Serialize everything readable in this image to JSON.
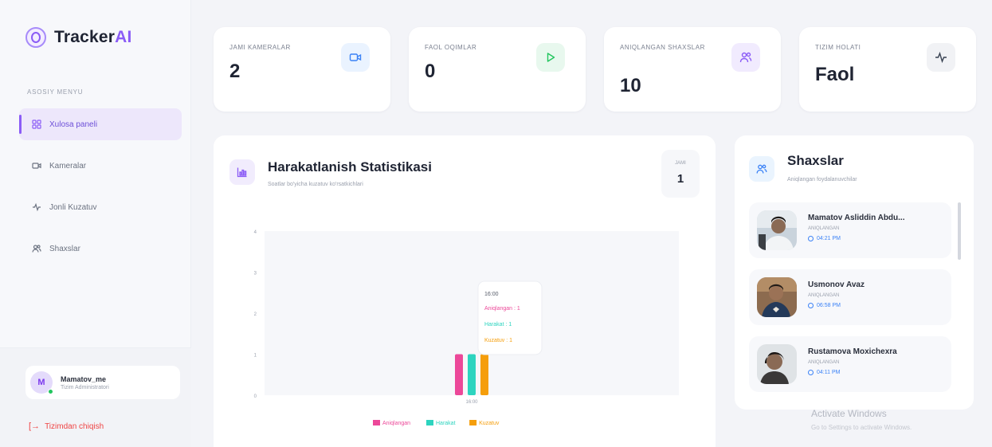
{
  "brand": {
    "name_main": "Tracker",
    "name_accent": "AI"
  },
  "sidebar": {
    "section_label": "ASOSIY MENYU",
    "items": [
      {
        "label": "Xulosa paneli",
        "icon": "dashboard-grid-icon",
        "active": true
      },
      {
        "label": "Kameralar",
        "icon": "camera-icon",
        "active": false
      },
      {
        "label": "Jonli Kuzatuv",
        "icon": "pulse-icon",
        "active": false
      },
      {
        "label": "Shaxslar",
        "icon": "users-icon",
        "active": false
      }
    ],
    "user": {
      "initial": "M",
      "name": "Mamatov_me",
      "role": "Tizim Administratori"
    },
    "logout_label": "Tizimdan chiqish"
  },
  "stats": [
    {
      "label": "JAMI KAMERALAR",
      "value": "2",
      "icon": "camera-icon",
      "color": "#3b82f6",
      "bg": "#eaf3ff"
    },
    {
      "label": "FAOL OQIMLAR",
      "value": "0",
      "icon": "play-icon",
      "color": "#22c55e",
      "bg": "#e8f8ee"
    },
    {
      "label": "ANIQLANGAN SHAXSLAR",
      "value": "10",
      "icon": "users-icon",
      "color": "#8b5cf6",
      "bg": "#f1ebfe"
    },
    {
      "label": "TIZIM HOLATI",
      "value": "Faol",
      "icon": "pulse-icon",
      "color": "#374151",
      "bg": "#f1f2f5"
    }
  ],
  "chart": {
    "title": "Harakatlanish Statistikasi",
    "subtitle": "Soatlar bo'yicha kuzatuv ko'rsatkichlari",
    "jami_label": "JAMI",
    "jami_value": "1"
  },
  "chart_data": {
    "type": "bar",
    "categories": [
      "16:00"
    ],
    "series": [
      {
        "name": "Aniqlangan",
        "values": [
          1
        ],
        "color": "#ec4899"
      },
      {
        "name": "Harakat",
        "values": [
          1
        ],
        "color": "#2dd4bf"
      },
      {
        "name": "Kuzatuv",
        "values": [
          1
        ],
        "color": "#f59e0b"
      }
    ],
    "ylim": [
      0,
      4
    ],
    "yticks": [
      "0",
      "1",
      "2",
      "3",
      "4"
    ],
    "xlabel": "",
    "ylabel": "",
    "grid": false,
    "legend": "bottom",
    "tooltip": {
      "title": "16:00",
      "lines": [
        "Aniqlangan : 1",
        "Harakat : 1",
        "Kuzatuv : 1"
      ]
    }
  },
  "people": {
    "title": "Shaxslar",
    "subtitle": "Aniqlangan foydalanuvchilar",
    "list": [
      {
        "name": "Mamatov Asliddin Abdu...",
        "meta": "ANIQLANGAN",
        "time": "04:21 PM"
      },
      {
        "name": "Usmonov Avaz",
        "meta": "ANIQLANGAN",
        "time": "06:58 PM"
      },
      {
        "name": "Rustamova Moxichexra",
        "meta": "ANIQLANGAN",
        "time": "04:11 PM"
      }
    ]
  },
  "watermark": {
    "title": "Activate Windows",
    "sub": "Go to Settings to activate Windows."
  }
}
